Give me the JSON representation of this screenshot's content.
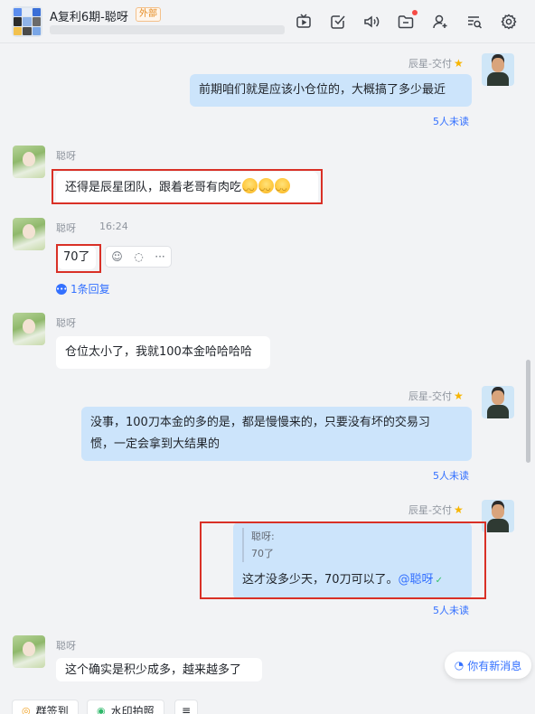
{
  "header": {
    "title": "A复利6期-聪呀",
    "tag": "外部",
    "icons": [
      "tv-icon",
      "checkbox-icon",
      "speaker-icon",
      "folder-icon",
      "add-member-icon",
      "search-list-icon",
      "settings-icon"
    ]
  },
  "messages": [
    {
      "sender": "辰星-交付",
      "text": "前期咱们就是应该小仓位的，大概搞了多少最近",
      "read_status": "5人未读"
    },
    {
      "sender": "聪呀",
      "text": "还得是辰星团队，跟着老哥有肉吃"
    },
    {
      "sender": "聪呀",
      "time": "16:24",
      "text": "70了",
      "reply_count": "1条回复"
    },
    {
      "sender": "聪呀",
      "text": "仓位太小了，我就100本金哈哈哈哈"
    },
    {
      "sender": "辰星-交付",
      "text_line1": "没事，100刀本金的多的是，都是慢慢来的，只要没有坏的交易习",
      "text_line2": "惯，一定会拿到大结果的",
      "read_status": "5人未读"
    },
    {
      "sender": "辰星-交付",
      "quote_name": "聪呀:",
      "quote_text": "70了",
      "text": "这才没多少天，70刀可以了。",
      "mention": "@聪呀",
      "read_status": "5人未读"
    },
    {
      "sender": "聪呀",
      "text": "这个确实是积少成多，越来越多了"
    }
  ],
  "new_message_label": "你有新消息",
  "bottom_bar": {
    "chip1": "群签到",
    "chip2": "水印拍照",
    "more": "≡"
  },
  "colors": {
    "accent": "#3370ff",
    "out_bubble": "#cce4fb",
    "highlight_box": "#d93026"
  }
}
